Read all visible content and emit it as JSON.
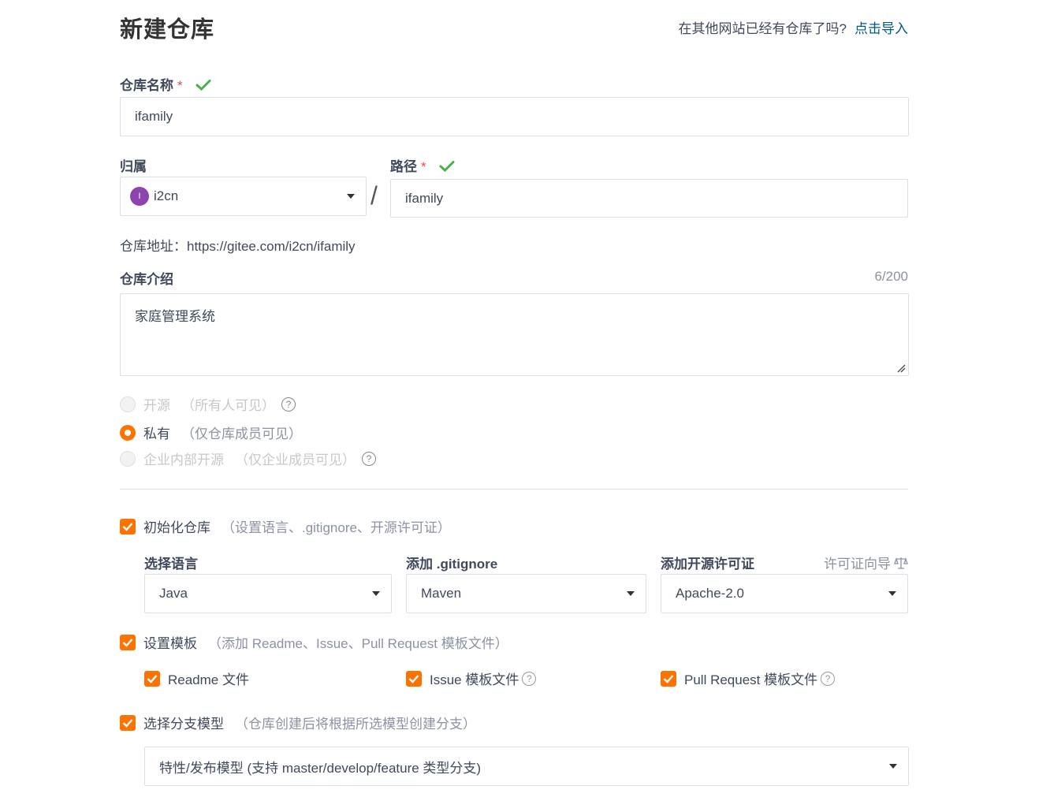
{
  "page_title": "新建仓库",
  "import": {
    "hint": "在其他网站已经有仓库了吗?",
    "link": "点击导入"
  },
  "repo_name": {
    "label": "仓库名称",
    "required": "*",
    "value": "ifamily"
  },
  "owner": {
    "label": "归属",
    "avatar_letter": "I",
    "value": "i2cn",
    "avatar_color": "#8e44ad"
  },
  "separator": "/",
  "path": {
    "label": "路径",
    "required": "*",
    "value": "ifamily"
  },
  "repo_address": "仓库地址：https://gitee.com/i2cn/ifamily",
  "description": {
    "label": "仓库介绍",
    "counter": "6/200",
    "value": "家庭管理系统"
  },
  "visibility": [
    {
      "label": "开源",
      "note": "（所有人可见）",
      "selected": false,
      "disabled": true,
      "help": "?"
    },
    {
      "label": "私有",
      "note": "（仅仓库成员可见）",
      "selected": true,
      "disabled": false,
      "help": ""
    },
    {
      "label": "企业内部开源",
      "note": "（仅企业成员可见）",
      "selected": false,
      "disabled": true,
      "help": "?"
    }
  ],
  "init_repo": {
    "label": "初始化仓库",
    "note": "（设置语言、.gitignore、开源许可证）",
    "checked": true
  },
  "language": {
    "label": "选择语言",
    "value": "Java"
  },
  "gitignore": {
    "label": "添加 .gitignore",
    "value": "Maven"
  },
  "license": {
    "label": "添加开源许可证",
    "guide": "许可证向导",
    "value": "Apache-2.0"
  },
  "templates": {
    "label": "设置模板",
    "note": "（添加 Readme、Issue、Pull Request 模板文件）",
    "checked": true
  },
  "template_items": [
    {
      "label": "Readme 文件",
      "checked": true,
      "help": ""
    },
    {
      "label": "Issue 模板文件",
      "checked": true,
      "help": "?"
    },
    {
      "label": "Pull Request 模板文件",
      "checked": true,
      "help": "?"
    }
  ],
  "branch_model": {
    "label": "选择分支模型",
    "note": "（仓库创建后将根据所选模型创建分支）",
    "checked": true,
    "value": "特性/发布模型 (支持 master/develop/feature 类型分支)"
  },
  "colors": {
    "accent": "#fe7300",
    "ok": "#4caf50",
    "link": "#005980",
    "required": "#e64a4a"
  }
}
